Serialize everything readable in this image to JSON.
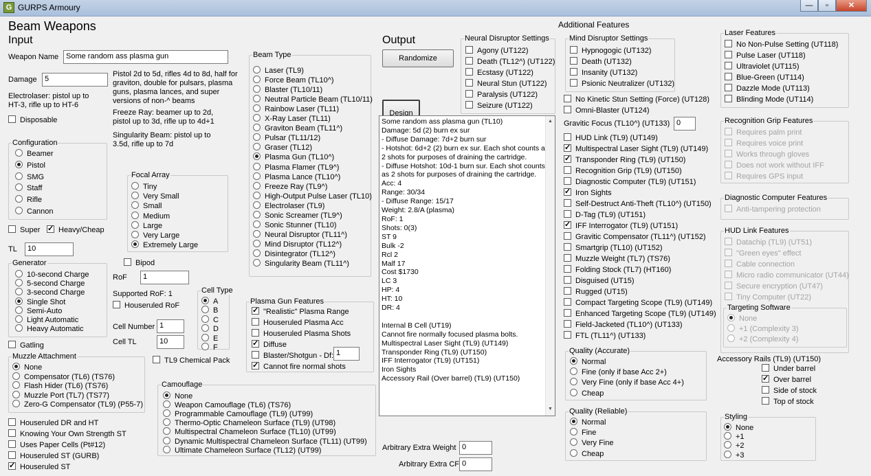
{
  "window": {
    "title": "GURPS Armoury"
  },
  "header": {
    "title": "Beam Weapons",
    "input": "Input",
    "output": "Output",
    "additional": "Additional Features"
  },
  "weapon": {
    "name_label": "Weapon Name",
    "name_value": "Some random ass plasma gun",
    "damage_label": "Damage",
    "damage_value": "5",
    "damage_note": [
      "Pistol 2d to 5d, rifles 4d to 8d, half for",
      "graviton, double for pulsars, plasma",
      "guns, plasma lances, and super",
      "versions of non-^ beams"
    ],
    "electro_note": [
      "Electrolaser: pistol up to",
      "HT-3, rifle up to HT-6"
    ],
    "freeze_note": [
      "Freeze Ray: beamer up to 2d,",
      "pistol up to 3d, rifle up to 4d+1"
    ],
    "sing_note": [
      "Singularity Beam: pistol up to",
      "3.5d, rifle up to 7d"
    ],
    "disposable": "Disposable",
    "super": "Super",
    "heavy": "Heavy/Cheap",
    "tl_label": "TL",
    "tl_value": "10",
    "bipod": "Bipod",
    "rof_label": "RoF",
    "rof_value": "1",
    "supported_rof": "Supported RoF: 1",
    "houseruled_rof": "Houseruled RoF",
    "cell_number_label": "Cell Number",
    "cell_number_value": "1",
    "cell_tl_label": "Cell TL",
    "cell_tl_value": "10",
    "gatling": "Gatling",
    "tl9_chem": "TL9 Chemical Pack"
  },
  "configuration": {
    "legend": "Configuration",
    "options": [
      "Beamer",
      "Pistol",
      "SMG",
      "Staff",
      "Rifle",
      "Cannon"
    ],
    "selected": 1
  },
  "focal": {
    "legend": "Focal Array",
    "options": [
      "Tiny",
      "Very Small",
      "Small",
      "Medium",
      "Large",
      "Very Large",
      "Extremely Large"
    ],
    "selected": 6
  },
  "generator": {
    "legend": "Generator",
    "options": [
      "10-second Charge",
      "5-second Charge",
      "3-second Charge",
      "Single Shot",
      "Semi-Auto",
      "Light Automatic",
      "Heavy Automatic"
    ],
    "selected": 3
  },
  "celltype": {
    "legend": "Cell Type",
    "options": [
      "A",
      "B",
      "C",
      "D",
      "E",
      "F"
    ],
    "selected": 0
  },
  "muzzle": {
    "legend": "Muzzle Attachment",
    "options": [
      "None",
      "Compensator (TL6) (TS76)",
      "Flash Hider (TL6) (TS76)",
      "Muzzle Port (TL7) (TS77)",
      "Zero-G Compensator (TL9) (P55-7)"
    ],
    "selected": 0
  },
  "bottom_checks": [
    {
      "label": "Houseruled DR and HT",
      "on": false
    },
    {
      "label": "Knowing Your Own Strength ST",
      "on": false
    },
    {
      "label": "Uses Paper Cells (Pt#12)",
      "on": false
    },
    {
      "label": "Houseruled ST (GURB)",
      "on": false
    },
    {
      "label": "Houseruled ST",
      "on": true
    }
  ],
  "beamtype": {
    "legend": "Beam Type",
    "options": [
      "Laser (TL9)",
      "Force Beam (TL10^)",
      "Blaster (TL10/11)",
      "Neutral Particle Beam (TL10/11)",
      "Rainbow Laser (TL11)",
      "X-Ray Laser (TL11)",
      "Graviton Beam (TL11^)",
      "Pulsar (TL11/12)",
      "Graser (TL12)",
      "Plasma Gun (TL10^)",
      "Plasma Flamer (TL9^)",
      "Plasma Lance (TL10^)",
      "Freeze Ray (TL9^)",
      "High-Output Pulse Laser (TL10)",
      "Electrolaser (TL9)",
      "Sonic Screamer (TL9^)",
      "Sonic Stunner (TL10)",
      "Neural Disruptor (TL11^)",
      "Mind Disruptor (TL12^)",
      "Disintegrator (TL12^)",
      "Singularity Beam (TL11^)"
    ],
    "selected": 9
  },
  "plasma": {
    "legend": "Plasma Gun Features",
    "items": [
      {
        "label": "\"Realistic\" Plasma Range",
        "on": true
      },
      {
        "label": "Houseruled Plasma Acc",
        "on": false
      },
      {
        "label": "Houseruled Plasma Shots",
        "on": false
      },
      {
        "label": "Diffuse",
        "on": true
      },
      {
        "label": "Blaster/Shotgun - Df:",
        "on": false
      },
      {
        "label": "Cannot fire normal shots",
        "on": true
      }
    ],
    "df_value": "1"
  },
  "camo": {
    "legend": "Camouflage",
    "options": [
      "None",
      "Weapon Camouflage (TL6) (TS76)",
      "Programmable Camouflage (TL9) (UT99)",
      "Thermo-Optic Chameleon Surface (TL9) (UT98)",
      "Multispectral Chameleon Surface (TL10) (UT99)",
      "Dynamic Multispectral Chameleon Surface (TL11) (UT99)",
      "Ultimate Chameleon Surface (TL12) (UT99)"
    ],
    "selected": 0
  },
  "output": {
    "randomize": "Randomize",
    "design": "Design",
    "lines": [
      "Some random ass plasma gun (TL10)",
      "Damage: 5d (2) burn ex sur",
      "- Diffuse Damage: 7d+2 burn sur",
      "- Hotshot: 6d+2 (2) burn ex sur. Each shot counts as 2 shots for purposes of draining the cartridge.",
      "- Diffuse Hotshot: 10d-1 burn sur. Each shot counts as 2 shots for purposes of draining the cartridge.",
      "Acc: 4",
      "Range: 30/34",
      "- Diffuse Range: 15/17",
      "Weight: 2.8/A (plasma)",
      "RoF: 1",
      "Shots: 0(3)",
      "ST 9",
      "Bulk -2",
      "Rcl 2",
      "Malf 17",
      "Cost $1730",
      "LC 3",
      "HP: 4",
      "HT: 10",
      "DR: 4",
      "",
      "Internal B Cell (UT19)",
      "Cannot fire normally focused plasma bolts.",
      "Multispectral Laser Sight (TL9) (UT149)",
      "Transponder Ring (TL9) (UT150)",
      "IFF Interrogator (TL9) (UT151)",
      "Iron Sights",
      "Accessory Rail (Over barrel) (TL9) (UT150)"
    ],
    "extra_weight_label": "Arbitrary Extra Weight",
    "extra_weight_value": "0",
    "extra_cf_label": "Arbitrary Extra CF",
    "extra_cf_value": "0"
  },
  "neural": {
    "legend": "Neural Disruptor Settings",
    "items": [
      "Agony (UT122)",
      "Death (TL12^) (UT122)",
      "Ecstasy (UT122)",
      "Neural Stun (UT122)",
      "Paralysis (UT122)",
      "Seizure (UT122)"
    ]
  },
  "mind": {
    "legend": "Mind Disruptor Settings",
    "items": [
      "Hypnogogic (UT132)",
      "Death (UT132)",
      "Insanity (UT132)",
      "Psionic Neutralizer (UT132)"
    ]
  },
  "features": {
    "no_kinetic": "No Kinetic Stun Setting (Force) (UT128)",
    "omni": "Omni-Blaster (UT124)",
    "gravitic_label": "Gravitic Focus (TL10^) (UT133)",
    "gravitic_value": "0",
    "items": [
      {
        "label": "HUD Link (TL9) (UT149)",
        "on": false
      },
      {
        "label": "Multispectral Laser Sight (TL9) (UT149)",
        "on": true
      },
      {
        "label": "Transponder Ring (TL9) (UT150)",
        "on": true
      },
      {
        "label": "Recognition Grip (TL9) (UT150)",
        "on": false
      },
      {
        "label": "Diagnostic Computer (TL9) (UT151)",
        "on": false
      },
      {
        "label": "Iron Sights",
        "on": true
      },
      {
        "label": "Self-Destruct Anti-Theft (TL10^) (UT150)",
        "on": false
      },
      {
        "label": "D-Tag (TL9) (UT151)",
        "on": false
      },
      {
        "label": "IFF Interrogator (TL9) (UT151)",
        "on": true
      },
      {
        "label": "Gravitic Compensator (TL11^) (UT152)",
        "on": false
      },
      {
        "label": "Smartgrip (TL10) (UT152)",
        "on": false
      },
      {
        "label": "Muzzle Weight (TL7) (TS76)",
        "on": false
      },
      {
        "label": "Folding Stock (TL7) (HT160)",
        "on": false
      },
      {
        "label": "Disguised (UT15)",
        "on": false
      },
      {
        "label": "Rugged (UT15)",
        "on": false
      },
      {
        "label": "Compact Targeting Scope (TL9) (UT149)",
        "on": false
      },
      {
        "label": "Enhanced Targeting Scope (TL9) (UT149)",
        "on": false
      },
      {
        "label": "Field-Jacketed (TL10^) (UT133)",
        "on": false
      },
      {
        "label": "FTL (TL11^) (UT133)",
        "on": false
      }
    ]
  },
  "quality_acc": {
    "legend": "Quality (Accurate)",
    "options": [
      "Normal",
      "Fine (only if base Acc 2+)",
      "Very Fine (only if base Acc 4+)",
      "Cheap"
    ],
    "selected": 0
  },
  "quality_rel": {
    "legend": "Quality (Reliable)",
    "options": [
      "Normal",
      "Fine",
      "Very Fine",
      "Cheap"
    ],
    "selected": 0
  },
  "laser": {
    "legend": "Laser Features",
    "items": [
      "No Non-Pulse Setting (UT118)",
      "Pulse Laser (UT118)",
      "Ultraviolet (UT115)",
      "Blue-Green (UT114)",
      "Dazzle Mode (UT113)",
      "Blinding Mode (UT114)"
    ]
  },
  "recog": {
    "legend": "Recognition Grip Features",
    "items": [
      "Requires palm print",
      "Requires voice print",
      "Works through gloves",
      "Does not work without IFF",
      "Requires GPS input"
    ]
  },
  "diag": {
    "legend": "Diagnostic Computer Features",
    "items": [
      "Anti-tampering protection"
    ]
  },
  "hud": {
    "legend": "HUD Link Features",
    "items": [
      "Datachip (TL9) (UT51)",
      "\"Green eyes\" effect",
      "Cable connection",
      "Micro radio communicator (UT44)",
      "Secure encryption (UT47)",
      "Tiny Computer (UT22)"
    ]
  },
  "targeting": {
    "legend": "Targeting Software",
    "options": [
      "None",
      "+1 (Complexity 3)",
      "+2 (Complexity 4)"
    ],
    "selected": 0
  },
  "rails": {
    "label": "Accessory Rails (TL9) (UT150)",
    "items": [
      {
        "label": "Under barrel",
        "on": false
      },
      {
        "label": "Over barrel",
        "on": true
      },
      {
        "label": "Side of stock",
        "on": false
      },
      {
        "label": "Top of stock",
        "on": false
      }
    ]
  },
  "styling": {
    "legend": "Styling",
    "options": [
      "None",
      "+1",
      "+2",
      "+3"
    ],
    "selected": 0
  }
}
